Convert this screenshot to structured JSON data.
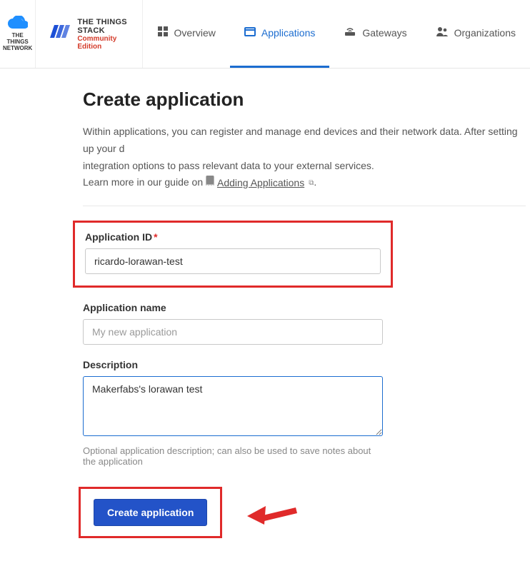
{
  "header": {
    "ttn_logo_text": "THE THINGS NETWORK",
    "stack_title": "THE THINGS STACK",
    "stack_subtitle": "Community Edition",
    "nav": [
      {
        "label": "Overview",
        "icon": "dashboard"
      },
      {
        "label": "Applications",
        "icon": "app",
        "active": true
      },
      {
        "label": "Gateways",
        "icon": "gateway"
      },
      {
        "label": "Organizations",
        "icon": "org"
      }
    ]
  },
  "page": {
    "title": "Create application",
    "intro_line1": "Within applications, you can register and manage end devices and their network data. After setting up your d",
    "intro_line2": "integration options to pass relevant data to your external services.",
    "intro_learn": "Learn more in our guide on",
    "intro_link": "Adding Applications",
    "intro_period": "."
  },
  "form": {
    "app_id": {
      "label": "Application ID",
      "required": "*",
      "value": "ricardo-lorawan-test"
    },
    "app_name": {
      "label": "Application name",
      "placeholder": "My new application",
      "value": ""
    },
    "description": {
      "label": "Description",
      "value": "Makerfabs's lorawan test",
      "help": "Optional application description; can also be used to save notes about the application"
    },
    "submit_label": "Create application"
  }
}
